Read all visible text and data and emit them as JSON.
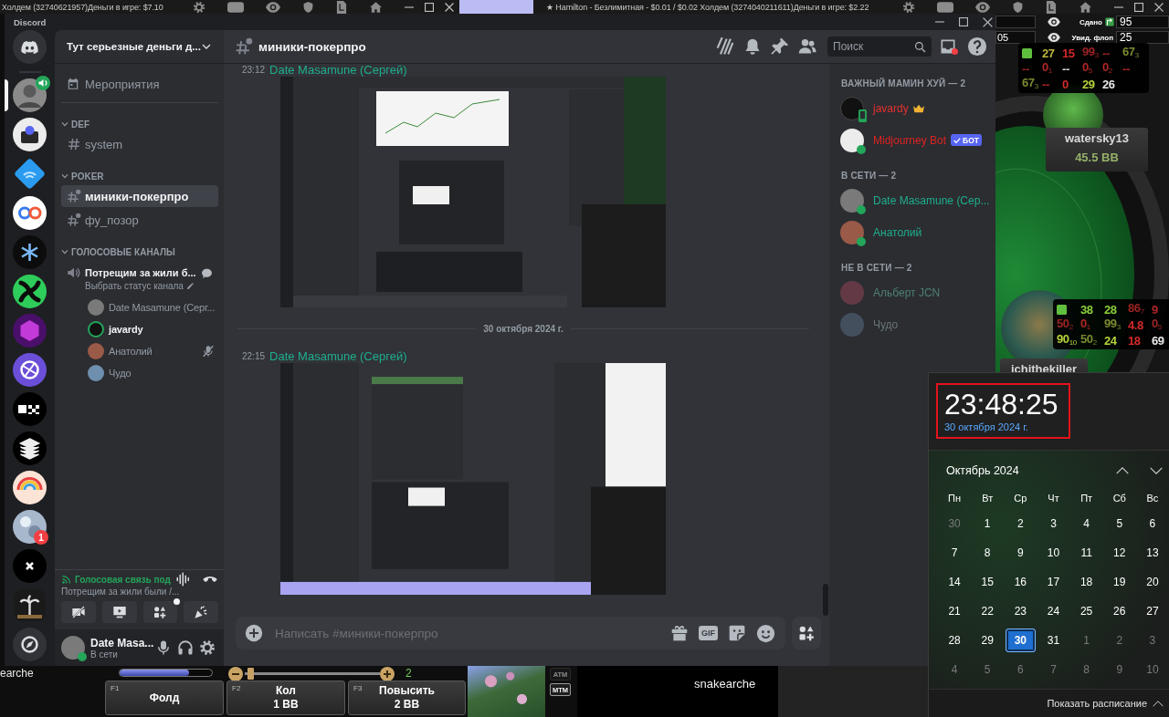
{
  "poker": {
    "title_bars": [
      {
        "title": "Холдем (32740621957)Деньги в игре: $7.10"
      },
      {
        "title": "★ Hamilton - Безлимитная - $0.01 / $0.02 Холдем (3274040211611)Деньги в игре: $2.22"
      }
    ],
    "stats": [
      {
        "label": "Сдано",
        "value": "95"
      },
      {
        "label": "Увид. флоп",
        "value": "25",
        "side": "05"
      }
    ],
    "huds": [
      {
        "rows": [
          [
            {
              "kind": "marker",
              "color": "#5fbf3f"
            },
            {
              "kind": "stat",
              "text": "27",
              "color": "#bdb43c"
            },
            {
              "kind": "stat",
              "text": "15",
              "color": "#d42a2a"
            },
            {
              "kind": "stat",
              "text": "99$_{3}$",
              "color": "#9c2424"
            },
            {
              "kind": "stat",
              "text": "--",
              "color": "#9c2424"
            },
            {
              "kind": "stat",
              "text": "67$_{3}$",
              "color": "#7a8a30"
            }
          ],
          [
            {
              "kind": "stat",
              "text": "--",
              "color": "#9c2424"
            },
            {
              "kind": "stat",
              "text": "0$_{1}$",
              "color": "#b02626"
            },
            {
              "kind": "stat",
              "text": "--",
              "color": "#d8d8d8"
            },
            {
              "kind": "stat",
              "text": "0$_{5}$",
              "color": "#b02626"
            },
            {
              "kind": "stat",
              "text": "0$_{2}$",
              "color": "#b02626"
            },
            {
              "kind": "stat",
              "text": "--",
              "color": "#b02626"
            }
          ],
          [
            {
              "kind": "stat",
              "text": "67$_{3}$",
              "color": "#7a8a30"
            },
            {
              "kind": "stat",
              "text": "--",
              "color": "#b02626"
            },
            {
              "kind": "stat",
              "text": "0",
              "color": "#d42a2a"
            },
            {
              "kind": "stat",
              "text": "29",
              "color": "#b6d23c"
            },
            {
              "kind": "stat",
              "text": "26",
              "color": "#e8e8e8"
            }
          ]
        ]
      },
      {
        "rows": [
          [
            {
              "kind": "marker",
              "color": "#5fbf3f"
            },
            {
              "kind": "stat",
              "text": "38",
              "color": "#8ccf3c"
            },
            {
              "kind": "stat",
              "text": "28",
              "color": "#8ccf3c"
            },
            {
              "kind": "stat",
              "text": "86$_{7}$",
              "color": "#9c2424"
            },
            {
              "kind": "stat",
              "text": "9",
              "color": "#b02626"
            }
          ],
          [
            {
              "kind": "stat",
              "text": "50$_{2}$",
              "color": "#9c2424"
            },
            {
              "kind": "stat",
              "text": "0$_{1}$",
              "color": "#b02626"
            },
            {
              "kind": "stat",
              "text": "99$_{3}$",
              "color": "#7a8a30"
            },
            {
              "kind": "stat",
              "text": "4.8",
              "color": "#d42a2a"
            },
            {
              "kind": "stat",
              "text": "0$_{5}$",
              "color": "#9c2424"
            }
          ],
          [
            {
              "kind": "stat",
              "text": "90$_{10}$",
              "color": "#b6d23c"
            },
            {
              "kind": "stat",
              "text": "50$_{2}$",
              "color": "#7a8a30"
            },
            {
              "kind": "stat",
              "text": "24",
              "color": "#b6d23c"
            },
            {
              "kind": "stat",
              "text": "18",
              "color": "#d42a2a"
            },
            {
              "kind": "stat",
              "text": "69",
              "color": "#e8e8e8"
            }
          ]
        ]
      }
    ],
    "players": [
      {
        "name": "watersky13",
        "stack": "45.5 BB"
      },
      {
        "name": "ichithekiller"
      }
    ],
    "left_name": "earche",
    "timer": {
      "level": 0.75
    },
    "bet": {
      "level": 0.02,
      "value": "2"
    },
    "actions": [
      {
        "key": "F1",
        "label": "Фолд"
      },
      {
        "key": "F2",
        "label": "Кол",
        "amount": "1 BB"
      },
      {
        "key": "F3",
        "label": "Повысить",
        "amount": "2 BB"
      }
    ],
    "toggles": [
      {
        "label": "ATM",
        "on": false
      },
      {
        "label": "MTM",
        "on": true
      }
    ],
    "bottom_player": "snakearche"
  },
  "discord": {
    "app_title": "Discord",
    "servers": [
      {
        "selected": true,
        "voice": true
      },
      {
        "selected": false,
        "voice": false
      },
      {
        "selected": false,
        "voice": false
      },
      {
        "selected": false,
        "voice": false
      },
      {
        "selected": false,
        "voice": false
      },
      {
        "selected": false,
        "voice": false
      },
      {
        "selected": false,
        "voice": false
      },
      {
        "selected": false,
        "voice": false
      },
      {
        "selected": false,
        "voice": false
      },
      {
        "selected": false,
        "voice": false
      },
      {
        "selected": false,
        "voice": false
      },
      {
        "selected": false,
        "voice": false,
        "badge": "1"
      },
      {
        "selected": false,
        "voice": false
      },
      {
        "selected": false,
        "voice": false
      }
    ],
    "server_name": "Тут серьезные деньги д...",
    "events": "Мероприятия",
    "categories": [
      {
        "name": "DEF",
        "channels": [
          {
            "name": "system",
            "locked": false,
            "selected": false
          }
        ]
      },
      {
        "name": "POKER",
        "channels": [
          {
            "name": "миники-покерпро",
            "locked": true,
            "selected": true
          },
          {
            "name": "фу_позор",
            "locked": true,
            "selected": false
          }
        ]
      },
      {
        "name": "ГОЛОСОВЫЕ КАНАЛЫ",
        "voice_channels": [
          {
            "name": "Потрещим за жили б...",
            "status_hint": "Выбрать статус канала",
            "users": [
              {
                "name": "Date Masamune (Серг...",
                "speaking": false,
                "muted": false
              },
              {
                "name": "javardy",
                "speaking": true,
                "muted": false
              },
              {
                "name": "Анатолий",
                "speaking": false,
                "muted": true
              },
              {
                "name": "Чудо",
                "speaking": false,
                "muted": false
              }
            ]
          }
        ]
      }
    ],
    "voice_panel": {
      "status": "Голосовая связь под",
      "channel": "Потрещим за жили были /...",
      "activities_badge": true
    },
    "user": {
      "name": "Date Masa...",
      "status": "В сети",
      "online": true
    },
    "header": {
      "channel": "миники-покерпро",
      "search_placeholder": "Поиск",
      "inbox_unread": true
    },
    "messages": [
      {
        "kind": "message",
        "time": "23:12",
        "author": "Date Masamune (Сергей)"
      },
      {
        "kind": "divider",
        "text": "30 октября 2024 г."
      },
      {
        "kind": "message",
        "time": "22:15",
        "author": "Date Masamune (Сергей)"
      }
    ],
    "composer": {
      "placeholder": "Написать #миники-покерпро",
      "gif": "GIF"
    },
    "member_groups": [
      {
        "title": "ВАЖНЫЙ МАМИН ХУЙ — 2",
        "members": [
          {
            "name": "javardy",
            "color": "#e8302f",
            "online": true,
            "mobile": true,
            "owner": true
          },
          {
            "name": "Midjourney Bot",
            "color": "#e02222",
            "online": true,
            "mobile": false,
            "owner": false,
            "tag": "БОТ"
          }
        ]
      },
      {
        "title": "В СЕТИ — 2",
        "members": [
          {
            "name": "Date Masamune (Сер...",
            "color": "#1fae8c",
            "online": true,
            "mobile": false,
            "owner": false
          },
          {
            "name": "Анатолий",
            "color": "#1fae8c",
            "online": true,
            "mobile": false,
            "owner": false
          }
        ]
      },
      {
        "title": "НЕ В СЕТИ — 2",
        "members": [
          {
            "name": "Альберт JCN",
            "color": "#4e7f73",
            "online": false,
            "mobile": false,
            "owner": false
          },
          {
            "name": "Чудо",
            "color": "#6a7676",
            "online": false,
            "mobile": false,
            "owner": false
          }
        ]
      }
    ]
  },
  "calendar": {
    "time": "23:48:25",
    "date": "30 октября 2024 г.",
    "highlighted": true,
    "month": "Октябрь 2024",
    "weekdays": [
      "Пн",
      "Вт",
      "Ср",
      "Чт",
      "Пт",
      "Сб",
      "Вс"
    ],
    "weeks": [
      [
        {
          "day": "30",
          "outside": true,
          "selected": false
        },
        {
          "day": "1",
          "outside": false,
          "selected": false
        },
        {
          "day": "2",
          "outside": false,
          "selected": false
        },
        {
          "day": "3",
          "outside": false,
          "selected": false
        },
        {
          "day": "4",
          "outside": false,
          "selected": false
        },
        {
          "day": "5",
          "outside": false,
          "selected": false
        },
        {
          "day": "6",
          "outside": false,
          "selected": false
        }
      ],
      [
        {
          "day": "7",
          "outside": false,
          "selected": false
        },
        {
          "day": "8",
          "outside": false,
          "selected": false
        },
        {
          "day": "9",
          "outside": false,
          "selected": false
        },
        {
          "day": "10",
          "outside": false,
          "selected": false
        },
        {
          "day": "11",
          "outside": false,
          "selected": false
        },
        {
          "day": "12",
          "outside": false,
          "selected": false
        },
        {
          "day": "13",
          "outside": false,
          "selected": false
        }
      ],
      [
        {
          "day": "14",
          "outside": false,
          "selected": false
        },
        {
          "day": "15",
          "outside": false,
          "selected": false
        },
        {
          "day": "16",
          "outside": false,
          "selected": false
        },
        {
          "day": "17",
          "outside": false,
          "selected": false
        },
        {
          "day": "18",
          "outside": false,
          "selected": false
        },
        {
          "day": "19",
          "outside": false,
          "selected": false
        },
        {
          "day": "20",
          "outside": false,
          "selected": false
        }
      ],
      [
        {
          "day": "21",
          "outside": false,
          "selected": false
        },
        {
          "day": "22",
          "outside": false,
          "selected": false
        },
        {
          "day": "23",
          "outside": false,
          "selected": false
        },
        {
          "day": "24",
          "outside": false,
          "selected": false
        },
        {
          "day": "25",
          "outside": false,
          "selected": false
        },
        {
          "day": "26",
          "outside": false,
          "selected": false
        },
        {
          "day": "27",
          "outside": false,
          "selected": false
        }
      ],
      [
        {
          "day": "28",
          "outside": false,
          "selected": false
        },
        {
          "day": "29",
          "outside": false,
          "selected": false
        },
        {
          "day": "30",
          "outside": false,
          "selected": true
        },
        {
          "day": "31",
          "outside": false,
          "selected": false
        },
        {
          "day": "1",
          "outside": true,
          "selected": false
        },
        {
          "day": "2",
          "outside": true,
          "selected": false
        },
        {
          "day": "3",
          "outside": true,
          "selected": false
        }
      ],
      [
        {
          "day": "4",
          "outside": true,
          "selected": false
        },
        {
          "day": "5",
          "outside": true,
          "selected": false
        },
        {
          "day": "6",
          "outside": true,
          "selected": false
        },
        {
          "day": "7",
          "outside": true,
          "selected": false
        },
        {
          "day": "8",
          "outside": true,
          "selected": false
        },
        {
          "day": "9",
          "outside": true,
          "selected": false
        },
        {
          "day": "10",
          "outside": true,
          "selected": false
        }
      ]
    ],
    "footer": "Показать расписание"
  }
}
